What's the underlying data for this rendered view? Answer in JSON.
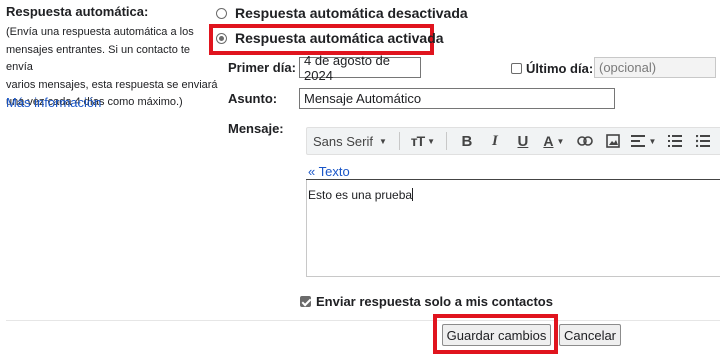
{
  "left": {
    "title": "Respuesta automática:",
    "description_lines": [
      "(Envía una respuesta automática a los",
      "mensajes entrantes. Si un contacto te envía",
      "varios mensajes, esta respuesta se enviará",
      "una vez cada 4 días como máximo.)"
    ],
    "more_info": "Más información"
  },
  "options": {
    "off_label": "Respuesta automática desactivada",
    "on_label": "Respuesta automática activada",
    "selected": "on"
  },
  "form": {
    "first_day_label": "Primer día:",
    "first_day_value": "4 de agosto de 2024",
    "last_day_label": "Último día:",
    "last_day_placeholder": "(opcional)",
    "last_day_checked": false,
    "subject_label": "Asunto:",
    "subject_value": "Mensaje Automático",
    "message_label": "Mensaje:"
  },
  "editor": {
    "font_name": "Sans Serif",
    "text_mode_link": "« Texto",
    "body": "Esto es una prueba",
    "toolbar_icons": [
      "font-size-icon",
      "bold-icon",
      "italic-icon",
      "underline-icon",
      "text-color-icon",
      "link-icon",
      "image-icon",
      "align-icon",
      "numbered-list-icon",
      "bulleted-list-icon"
    ]
  },
  "contacts_only": {
    "label": "Enviar respuesta solo a mis contactos",
    "checked": true
  },
  "buttons": {
    "save": "Guardar cambios",
    "cancel": "Cancelar"
  },
  "colors": {
    "highlight": "#e0141e",
    "link": "#1a56c7"
  }
}
